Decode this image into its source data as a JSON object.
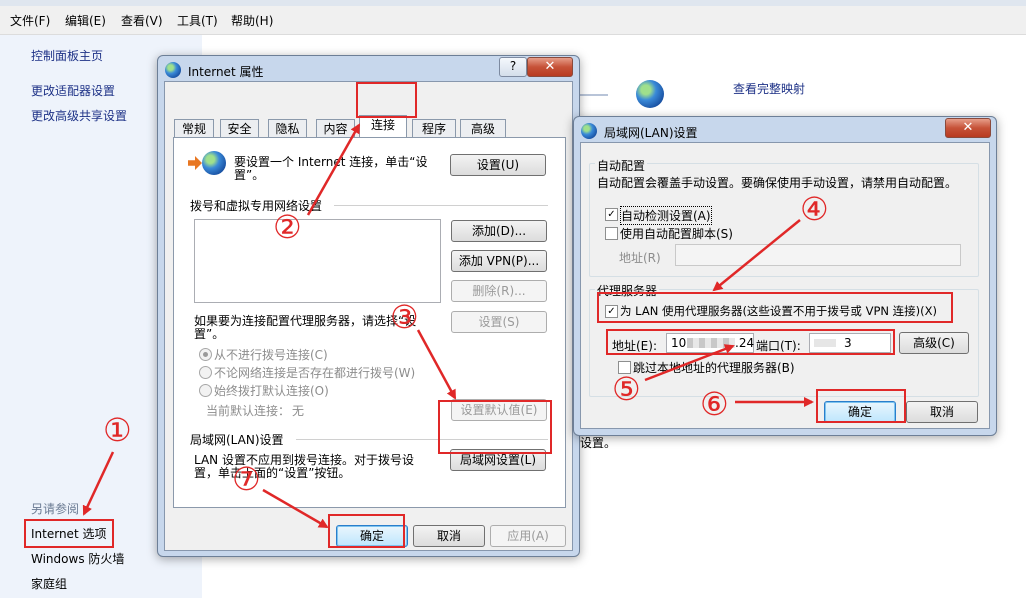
{
  "menubar": {
    "items": [
      "文件(F)",
      "编辑(E)",
      "查看(V)",
      "工具(T)",
      "帮助(H)"
    ]
  },
  "left_pane": {
    "links": [
      "控制面板主页",
      "更改适配器设置",
      "更改高级共享设置"
    ],
    "see_also": "另请参阅",
    "bottom_links": [
      "Internet 选项",
      "Windows 防火墙",
      "家庭组"
    ]
  },
  "background": {
    "map_link": "查看完整映射",
    "tail_text": "设置。"
  },
  "inet": {
    "title": "Internet 属性",
    "help": "?",
    "close": "✕",
    "tabs": [
      "常规",
      "安全",
      "隐私",
      "内容",
      "连接",
      "程序",
      "高级"
    ],
    "setup_text_1": "要设置一个 Internet 连接，单击“设",
    "setup_text_2": "置”。",
    "setup_btn": "设置(U)",
    "dialup_header": "拨号和虚拟专用网络设置",
    "add_btn": "添加(D)...",
    "add_vpn_btn": "添加 VPN(P)...",
    "remove_btn": "删除(R)...",
    "proxy_text_1": "如果要为连接配置代理服务器，请选择“设",
    "proxy_text_2": "置”。",
    "settings_btn": "设置(S)",
    "radio_never": "从不进行拨号连接(C)",
    "radio_when_none": "不论网络连接是否存在都进行拨号(W)",
    "radio_always": "始终拨打默认连接(O)",
    "current_default_label": "当前默认连接：",
    "current_default_value": "无",
    "set_default_btn": "设置默认值(E)",
    "lan_header": "局域网(LAN)设置",
    "lan_text_1": "LAN 设置不应用到拨号连接。对于拨号设",
    "lan_text_2": "置，单击上面的“设置”按钮。",
    "lan_btn": "局域网设置(L)",
    "ok": "确定",
    "cancel": "取消",
    "apply": "应用(A)"
  },
  "lan": {
    "title": "局域网(LAN)设置",
    "close": "✕",
    "auto_header": "自动配置",
    "auto_desc": "自动配置会覆盖手动设置。要确保使用手动设置，请禁用自动配置。",
    "auto_detect_label": "自动检测设置(A)",
    "auto_detect_checked": true,
    "auto_script_label": "使用自动配置脚本(S)",
    "auto_script_checked": false,
    "addr_label_disabled": "地址(R)",
    "proxy_header": "代理服务器",
    "use_proxy_label": "为 LAN 使用代理服务器(这些设置不用于拨号或 VPN 连接)(X)",
    "use_proxy_checked": true,
    "address_label": "地址(E):",
    "address_value": "10",
    "address_value_tail": ".24",
    "port_label": "端口(T):",
    "port_value": "3",
    "advanced_btn": "高级(C)",
    "bypass_label": "跳过本地地址的代理服务器(B)",
    "bypass_checked": false,
    "ok": "确定",
    "cancel": "取消"
  },
  "annotations": {
    "c1": "①",
    "c2": "②",
    "c3": "③",
    "c4": "④",
    "c5": "⑤",
    "c6": "⑥",
    "c7": "⑦"
  },
  "colors": {
    "annotation_red": "#e02828",
    "link_blue": "#1e3287"
  }
}
